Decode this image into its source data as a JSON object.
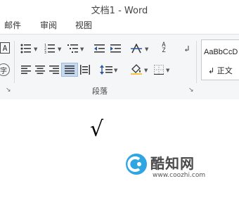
{
  "window": {
    "title": "文档1 - Word"
  },
  "tabs": [
    {
      "label": "邮件"
    },
    {
      "label": "审阅"
    },
    {
      "label": "视图"
    }
  ],
  "ribbon": {
    "paragraph_group_label": "段落",
    "styles": {
      "sample": "AaBbCcD",
      "name": "↲ 正文"
    }
  },
  "document": {
    "content": "√"
  },
  "watermark": {
    "title": "酷知网",
    "url": "www.coozhi.com"
  },
  "colors": {
    "accent": "#2b579a",
    "watermark_blue": "#2fa6e2",
    "ribbon_bg": "#f5f6f7"
  }
}
